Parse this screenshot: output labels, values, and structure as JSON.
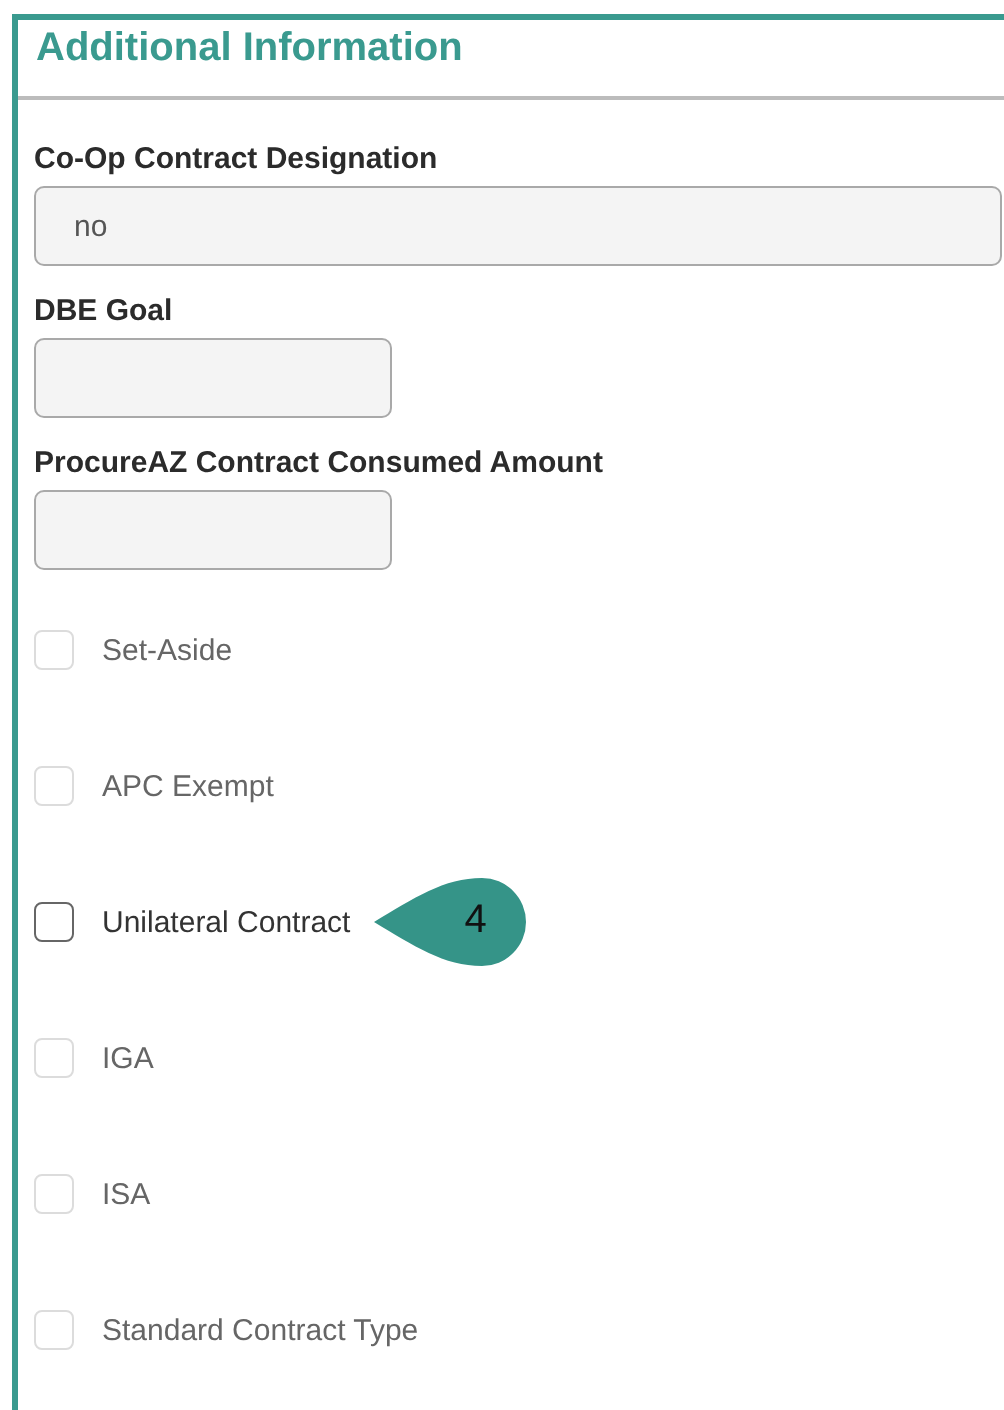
{
  "section": {
    "title": "Additional Information"
  },
  "fields": [
    {
      "label": "Co-Op Contract Designation",
      "value": "no",
      "kind": "wide"
    },
    {
      "label": "DBE Goal",
      "kind": "short"
    },
    {
      "label": "ProcureAZ Contract Consumed Amount",
      "kind": "short"
    }
  ],
  "checkboxes": [
    {
      "label": "Set-Aside",
      "checked": false,
      "disabled": true
    },
    {
      "label": "APC Exempt",
      "checked": false,
      "disabled": true
    },
    {
      "label": "Unilateral Contract",
      "checked": false,
      "disabled": false,
      "callout": "4"
    },
    {
      "label": "IGA",
      "checked": false,
      "disabled": true
    },
    {
      "label": "ISA",
      "checked": false,
      "disabled": true
    },
    {
      "label": "Standard Contract Type",
      "checked": false,
      "disabled": true
    }
  ]
}
